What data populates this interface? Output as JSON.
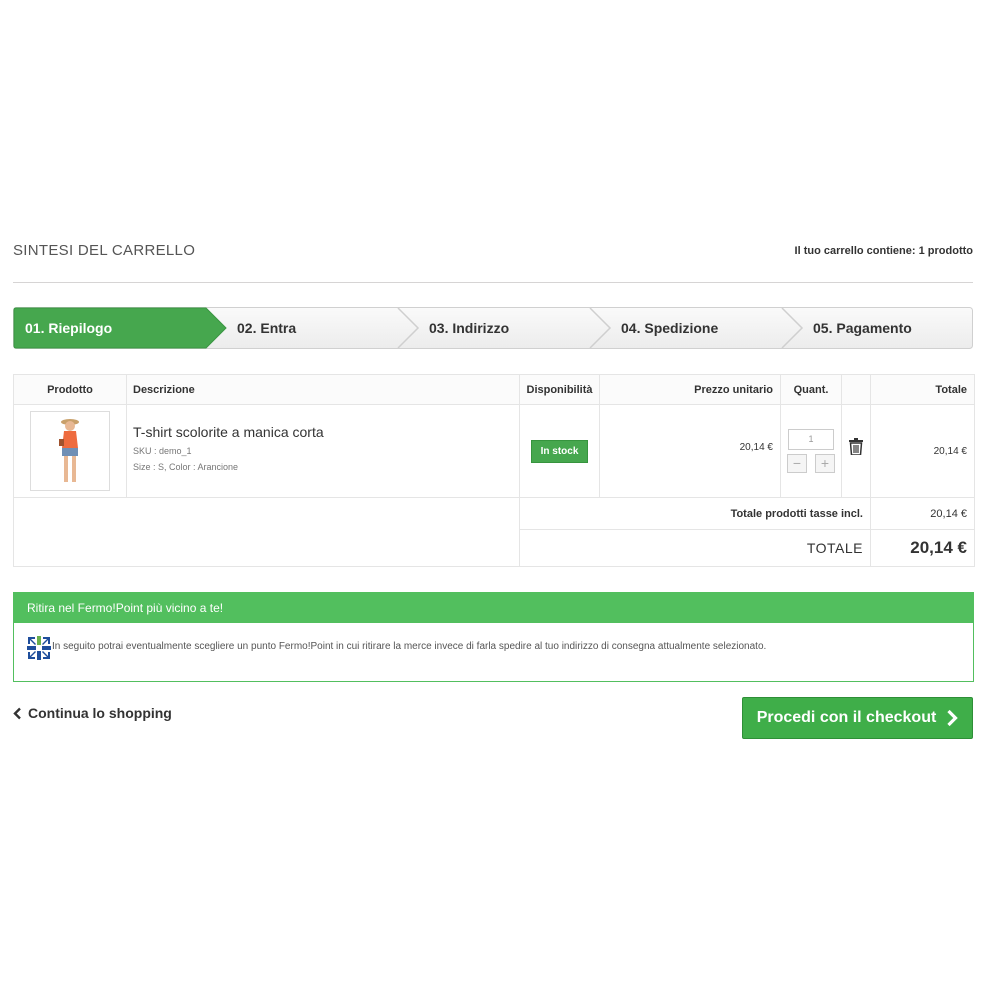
{
  "header": {
    "title": "SINTESI DEL CARRELLO",
    "cart_count": "Il tuo carrello contiene: 1 prodotto"
  },
  "steps": [
    {
      "label": "01. Riepilogo",
      "active": true
    },
    {
      "label": "02. Entra",
      "active": false
    },
    {
      "label": "03. Indirizzo",
      "active": false
    },
    {
      "label": "04. Spedizione",
      "active": false
    },
    {
      "label": "05. Pagamento",
      "active": false
    }
  ],
  "table": {
    "headers": {
      "product": "Prodotto",
      "description": "Descrizione",
      "availability": "Disponibilità",
      "unit_price": "Prezzo unitario",
      "quantity": "Quant.",
      "total": "Totale"
    },
    "item": {
      "name": "T-shirt scolorite a manica corta",
      "sku": "SKU : demo_1",
      "attributes": "Size : S, Color : Arancione",
      "availability": "In stock",
      "unit_price": "20,14 €",
      "quantity": "1",
      "minus": "−",
      "plus": "+",
      "total": "20,14 €"
    },
    "subtotal_label": "Totale prodotti tasse incl.",
    "subtotal_value": "20,14 €",
    "grand_total_label": "TOTALE",
    "grand_total_value": "20,14 €"
  },
  "fermopoint": {
    "heading": "Ritira nel Fermo!Point più vicino a te!",
    "text": "In seguito potrai eventualmente scegliere un punto Fermo!Point in cui ritirare la merce invece di farla spedire al tuo indirizzo di consegna attualmente selezionato."
  },
  "actions": {
    "continue_label": "Continua lo shopping",
    "checkout_label": "Procedi con il checkout"
  },
  "colors": {
    "accent_green": "#46a74e",
    "fermopoint_green": "#52bf5e",
    "checkout_green": "#3fae49"
  }
}
